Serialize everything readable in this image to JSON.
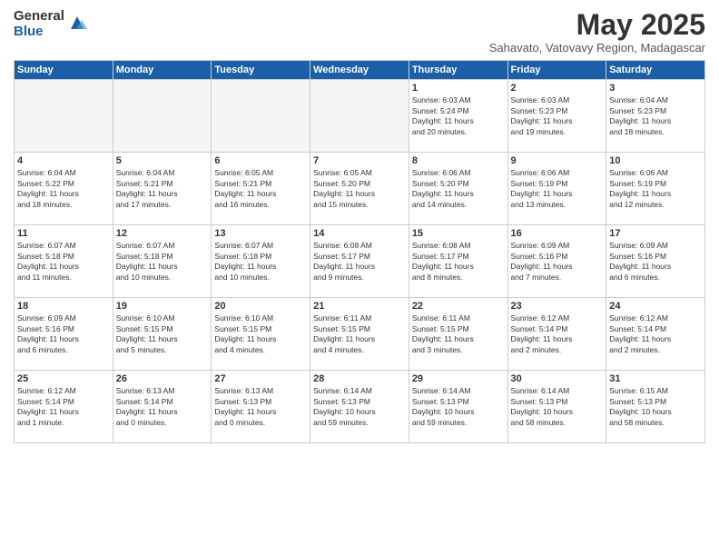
{
  "logo": {
    "general": "General",
    "blue": "Blue"
  },
  "title": "May 2025",
  "subtitle": "Sahavato, Vatovavy Region, Madagascar",
  "headers": [
    "Sunday",
    "Monday",
    "Tuesday",
    "Wednesday",
    "Thursday",
    "Friday",
    "Saturday"
  ],
  "weeks": [
    [
      {
        "day": "",
        "info": ""
      },
      {
        "day": "",
        "info": ""
      },
      {
        "day": "",
        "info": ""
      },
      {
        "day": "",
        "info": ""
      },
      {
        "day": "1",
        "info": "Sunrise: 6:03 AM\nSunset: 5:24 PM\nDaylight: 11 hours\nand 20 minutes."
      },
      {
        "day": "2",
        "info": "Sunrise: 6:03 AM\nSunset: 5:23 PM\nDaylight: 11 hours\nand 19 minutes."
      },
      {
        "day": "3",
        "info": "Sunrise: 6:04 AM\nSunset: 5:23 PM\nDaylight: 11 hours\nand 18 minutes."
      }
    ],
    [
      {
        "day": "4",
        "info": "Sunrise: 6:04 AM\nSunset: 5:22 PM\nDaylight: 11 hours\nand 18 minutes."
      },
      {
        "day": "5",
        "info": "Sunrise: 6:04 AM\nSunset: 5:21 PM\nDaylight: 11 hours\nand 17 minutes."
      },
      {
        "day": "6",
        "info": "Sunrise: 6:05 AM\nSunset: 5:21 PM\nDaylight: 11 hours\nand 16 minutes."
      },
      {
        "day": "7",
        "info": "Sunrise: 6:05 AM\nSunset: 5:20 PM\nDaylight: 11 hours\nand 15 minutes."
      },
      {
        "day": "8",
        "info": "Sunrise: 6:06 AM\nSunset: 5:20 PM\nDaylight: 11 hours\nand 14 minutes."
      },
      {
        "day": "9",
        "info": "Sunrise: 6:06 AM\nSunset: 5:19 PM\nDaylight: 11 hours\nand 13 minutes."
      },
      {
        "day": "10",
        "info": "Sunrise: 6:06 AM\nSunset: 5:19 PM\nDaylight: 11 hours\nand 12 minutes."
      }
    ],
    [
      {
        "day": "11",
        "info": "Sunrise: 6:07 AM\nSunset: 5:18 PM\nDaylight: 11 hours\nand 11 minutes."
      },
      {
        "day": "12",
        "info": "Sunrise: 6:07 AM\nSunset: 5:18 PM\nDaylight: 11 hours\nand 10 minutes."
      },
      {
        "day": "13",
        "info": "Sunrise: 6:07 AM\nSunset: 5:18 PM\nDaylight: 11 hours\nand 10 minutes."
      },
      {
        "day": "14",
        "info": "Sunrise: 6:08 AM\nSunset: 5:17 PM\nDaylight: 11 hours\nand 9 minutes."
      },
      {
        "day": "15",
        "info": "Sunrise: 6:08 AM\nSunset: 5:17 PM\nDaylight: 11 hours\nand 8 minutes."
      },
      {
        "day": "16",
        "info": "Sunrise: 6:09 AM\nSunset: 5:16 PM\nDaylight: 11 hours\nand 7 minutes."
      },
      {
        "day": "17",
        "info": "Sunrise: 6:09 AM\nSunset: 5:16 PM\nDaylight: 11 hours\nand 6 minutes."
      }
    ],
    [
      {
        "day": "18",
        "info": "Sunrise: 6:09 AM\nSunset: 5:16 PM\nDaylight: 11 hours\nand 6 minutes."
      },
      {
        "day": "19",
        "info": "Sunrise: 6:10 AM\nSunset: 5:15 PM\nDaylight: 11 hours\nand 5 minutes."
      },
      {
        "day": "20",
        "info": "Sunrise: 6:10 AM\nSunset: 5:15 PM\nDaylight: 11 hours\nand 4 minutes."
      },
      {
        "day": "21",
        "info": "Sunrise: 6:11 AM\nSunset: 5:15 PM\nDaylight: 11 hours\nand 4 minutes."
      },
      {
        "day": "22",
        "info": "Sunrise: 6:11 AM\nSunset: 5:15 PM\nDaylight: 11 hours\nand 3 minutes."
      },
      {
        "day": "23",
        "info": "Sunrise: 6:12 AM\nSunset: 5:14 PM\nDaylight: 11 hours\nand 2 minutes."
      },
      {
        "day": "24",
        "info": "Sunrise: 6:12 AM\nSunset: 5:14 PM\nDaylight: 11 hours\nand 2 minutes."
      }
    ],
    [
      {
        "day": "25",
        "info": "Sunrise: 6:12 AM\nSunset: 5:14 PM\nDaylight: 11 hours\nand 1 minute."
      },
      {
        "day": "26",
        "info": "Sunrise: 6:13 AM\nSunset: 5:14 PM\nDaylight: 11 hours\nand 0 minutes."
      },
      {
        "day": "27",
        "info": "Sunrise: 6:13 AM\nSunset: 5:13 PM\nDaylight: 11 hours\nand 0 minutes."
      },
      {
        "day": "28",
        "info": "Sunrise: 6:14 AM\nSunset: 5:13 PM\nDaylight: 10 hours\nand 59 minutes."
      },
      {
        "day": "29",
        "info": "Sunrise: 6:14 AM\nSunset: 5:13 PM\nDaylight: 10 hours\nand 59 minutes."
      },
      {
        "day": "30",
        "info": "Sunrise: 6:14 AM\nSunset: 5:13 PM\nDaylight: 10 hours\nand 58 minutes."
      },
      {
        "day": "31",
        "info": "Sunrise: 6:15 AM\nSunset: 5:13 PM\nDaylight: 10 hours\nand 58 minutes."
      }
    ]
  ]
}
